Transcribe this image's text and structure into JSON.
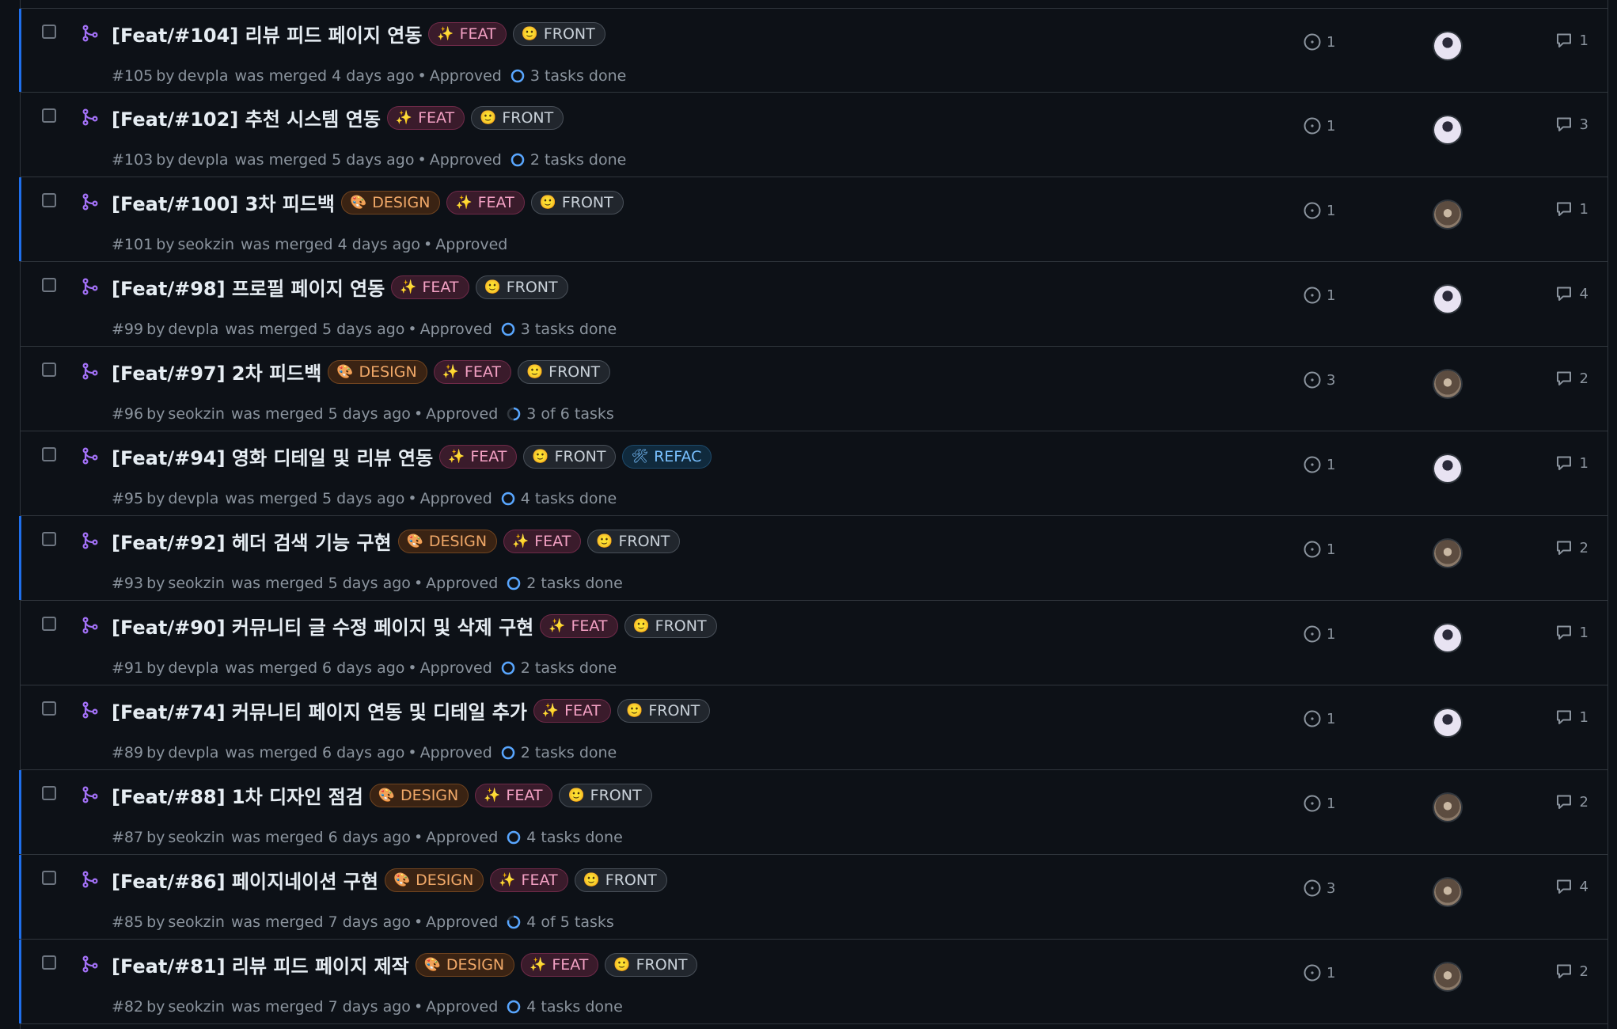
{
  "colors": {
    "background": "#0d1117",
    "border": "#30363d",
    "accent_bar": "#1f6feb",
    "merged_purple": "#a371f7",
    "muted_text": "#8b949e",
    "task_ring": "#58a6ff"
  },
  "icons": {
    "checkbox": "checkbox-icon",
    "merged": "git-merge-icon",
    "issue": "issue-opened-icon",
    "comment": "comment-icon",
    "task": "task-progress-icon",
    "feat_emoji": "sparkles-icon",
    "front_emoji": "smiley-icon",
    "design_emoji": "palette-icon",
    "refac_emoji": "hammer-wrench-icon"
  },
  "label_text": {
    "FEAT": "FEAT",
    "FRONT": "FRONT",
    "DESIGN": "DESIGN",
    "REFAC": "REFAC"
  },
  "pull_requests": [
    {
      "title": "[Feat/#104] 리뷰 피드 페이지 연동",
      "labels": [
        "FEAT",
        "FRONT"
      ],
      "number": "#105",
      "author": "devpla",
      "merged_text": "was merged 4 days ago",
      "review": "Approved",
      "tasks": "3 tasks done",
      "task_fraction": 1,
      "issues": "1",
      "comments": "1",
      "accent": true
    },
    {
      "title": "[Feat/#102] 추천 시스템 연동",
      "labels": [
        "FEAT",
        "FRONT"
      ],
      "number": "#103",
      "author": "devpla",
      "merged_text": "was merged 5 days ago",
      "review": "Approved",
      "tasks": "2 tasks done",
      "task_fraction": 1,
      "issues": "1",
      "comments": "3",
      "accent": false
    },
    {
      "title": "[Feat/#100] 3차 피드백",
      "labels": [
        "DESIGN",
        "FEAT",
        "FRONT"
      ],
      "number": "#101",
      "author": "seokzin",
      "merged_text": "was merged 4 days ago",
      "review": "Approved",
      "tasks": "",
      "task_fraction": null,
      "issues": "1",
      "comments": "1",
      "accent": true
    },
    {
      "title": "[Feat/#98] 프로필 페이지 연동",
      "labels": [
        "FEAT",
        "FRONT"
      ],
      "number": "#99",
      "author": "devpla",
      "merged_text": "was merged 5 days ago",
      "review": "Approved",
      "tasks": "3 tasks done",
      "task_fraction": 1,
      "issues": "1",
      "comments": "4",
      "accent": false
    },
    {
      "title": "[Feat/#97] 2차 피드백",
      "labels": [
        "DESIGN",
        "FEAT",
        "FRONT"
      ],
      "number": "#96",
      "author": "seokzin",
      "merged_text": "was merged 5 days ago",
      "review": "Approved",
      "tasks": "3 of 6 tasks",
      "task_fraction": 0.5,
      "issues": "3",
      "comments": "2",
      "accent": false
    },
    {
      "title": "[Feat/#94] 영화 디테일 및 리뷰 연동",
      "labels": [
        "FEAT",
        "FRONT",
        "REFAC"
      ],
      "number": "#95",
      "author": "devpla",
      "merged_text": "was merged 5 days ago",
      "review": "Approved",
      "tasks": "4 tasks done",
      "task_fraction": 1,
      "issues": "1",
      "comments": "1",
      "accent": false
    },
    {
      "title": "[Feat/#92] 헤더 검색 기능 구현",
      "labels": [
        "DESIGN",
        "FEAT",
        "FRONT"
      ],
      "number": "#93",
      "author": "seokzin",
      "merged_text": "was merged 5 days ago",
      "review": "Approved",
      "tasks": "2 tasks done",
      "task_fraction": 1,
      "issues": "1",
      "comments": "2",
      "accent": true
    },
    {
      "title": "[Feat/#90] 커뮤니티 글 수정 페이지 및 삭제 구현",
      "labels": [
        "FEAT",
        "FRONT"
      ],
      "number": "#91",
      "author": "devpla",
      "merged_text": "was merged 6 days ago",
      "review": "Approved",
      "tasks": "2 tasks done",
      "task_fraction": 1,
      "issues": "1",
      "comments": "1",
      "accent": false
    },
    {
      "title": "[Feat/#74] 커뮤니티 페이지 연동 및 디테일 추가",
      "labels": [
        "FEAT",
        "FRONT"
      ],
      "number": "#89",
      "author": "devpla",
      "merged_text": "was merged 6 days ago",
      "review": "Approved",
      "tasks": "2 tasks done",
      "task_fraction": 1,
      "issues": "1",
      "comments": "1",
      "accent": false
    },
    {
      "title": "[Feat/#88] 1차 디자인 점검",
      "labels": [
        "DESIGN",
        "FEAT",
        "FRONT"
      ],
      "number": "#87",
      "author": "seokzin",
      "merged_text": "was merged 6 days ago",
      "review": "Approved",
      "tasks": "4 tasks done",
      "task_fraction": 1,
      "issues": "1",
      "comments": "2",
      "accent": true
    },
    {
      "title": "[Feat/#86] 페이지네이션 구현",
      "labels": [
        "DESIGN",
        "FEAT",
        "FRONT"
      ],
      "number": "#85",
      "author": "seokzin",
      "merged_text": "was merged 7 days ago",
      "review": "Approved",
      "tasks": "4 of 5 tasks",
      "task_fraction": 0.8,
      "issues": "3",
      "comments": "4",
      "accent": true
    },
    {
      "title": "[Feat/#81] 리뷰 피드 페이지 제작",
      "labels": [
        "DESIGN",
        "FEAT",
        "FRONT"
      ],
      "number": "#82",
      "author": "seokzin",
      "merged_text": "was merged 7 days ago",
      "review": "Approved",
      "tasks": "4 tasks done",
      "task_fraction": 1,
      "issues": "1",
      "comments": "2",
      "accent": true
    }
  ]
}
